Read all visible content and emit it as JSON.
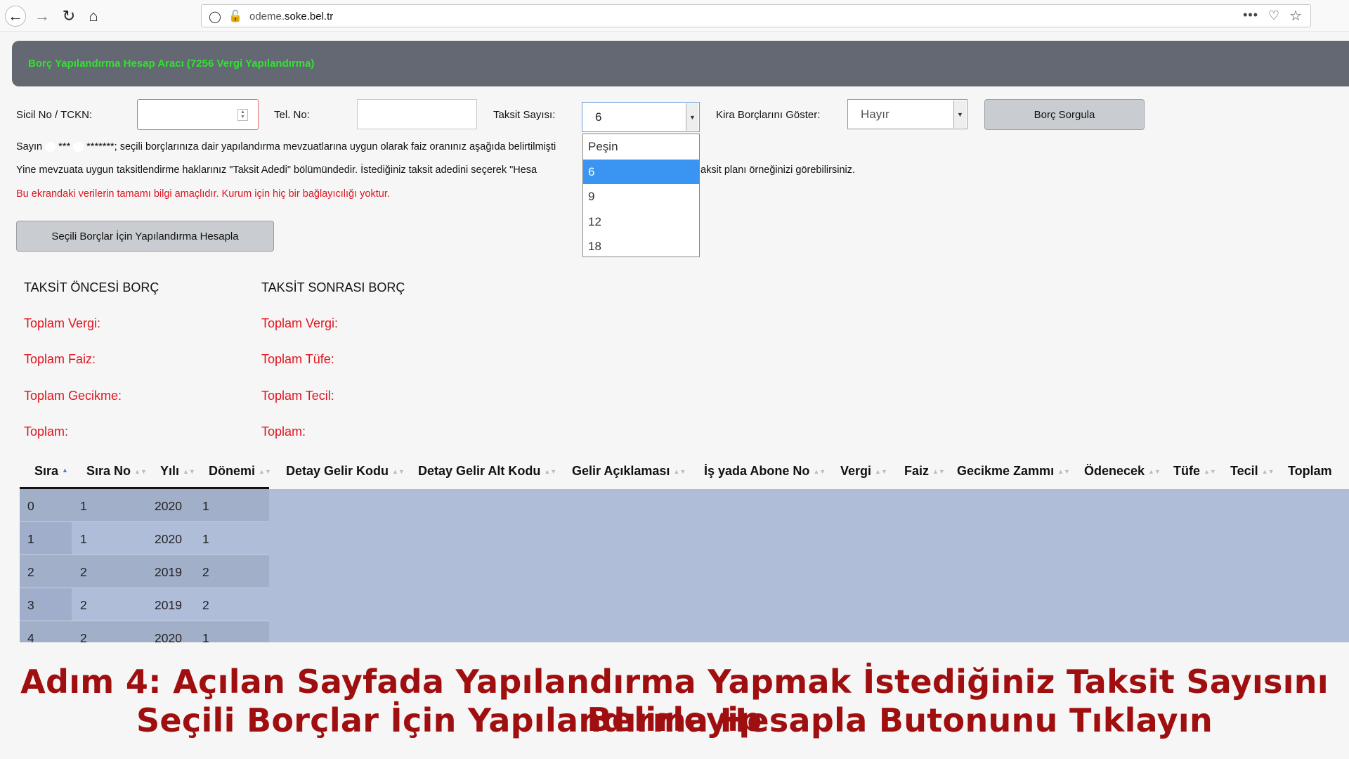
{
  "browser": {
    "url_prefix": "odeme.",
    "url_domain": "soke.bel.tr",
    "more_icon": "•••"
  },
  "header": {
    "title": "Borç Yapılandırma Hesap Aracı (7256 Vergi Yapılandırma)"
  },
  "form": {
    "sicil_label": "Sicil No / TCKN:",
    "tel_label": "Tel. No:",
    "taksit_label": "Taksit Sayısı:",
    "taksit_value": "6",
    "taksit_options": [
      "Peşin",
      "6",
      "9",
      "12",
      "18"
    ],
    "taksit_selected_index": 1,
    "kira_label": "Kira Borçlarını Göster:",
    "kira_value": "Hayır",
    "sorgula_button": "Borç Sorgula"
  },
  "info": {
    "line1_a": "Sayın",
    "line1_b": "***",
    "line1_c": "*******; seçili borçlarınıza dair yapılandırma mevzuatlarına uygun olarak faiz oranınız aşağıda belirtilmişti",
    "line2_a": "Yine mevzuata uygun taksitlendirme haklarınız \"Taksit Adedi\" bölümündedir. İstediğiniz taksit adedini seçerek \"Hesa",
    "line2_b": "aksit planı örneğinizi görebilirsiniz.",
    "warning": "Bu ekrandaki verilerin tamamı bilgi amaçlıdır. Kurum için hiç bir bağlayıcılığı yoktur.",
    "hesapla_button": "Seçili Borçlar İçin Yapılandırma Hesapla"
  },
  "totals": {
    "before_title": "TAKSİT ÖNCESİ BORÇ",
    "before": [
      "Toplam Vergi:",
      "Toplam Faiz:",
      "Toplam Gecikme:",
      "Toplam:"
    ],
    "after_title": "TAKSİT SONRASI BORÇ",
    "after": [
      "Toplam Vergi:",
      "Toplam Tüfe:",
      "Toplam Tecil:",
      "Toplam:"
    ]
  },
  "table": {
    "headers": [
      "Sıra",
      "Sıra No",
      "Yılı",
      "Dönemi",
      "Detay Gelir Kodu",
      "Detay Gelir Alt Kodu",
      "Gelir Açıklaması",
      "İş yada Abone No",
      "Vergi",
      "Faiz",
      "Gecikme Zammı",
      "Ödenecek",
      "Tüfe",
      "Tecil",
      "Toplam"
    ],
    "rows": [
      [
        "0",
        "1",
        "2020",
        "1"
      ],
      [
        "1",
        "1",
        "2020",
        "1"
      ],
      [
        "2",
        "2",
        "2019",
        "2"
      ],
      [
        "3",
        "2",
        "2019",
        "2"
      ],
      [
        "4",
        "2",
        "2020",
        "1"
      ]
    ]
  },
  "caption": {
    "line1": "Adım 4: Açılan Sayfada Yapılandırma Yapmak İstediğiniz Taksit Sayısını Belirleyip",
    "line2": "Seçili Borçlar İçin Yapılandırma Hesapla Butonunu Tıklayın"
  }
}
